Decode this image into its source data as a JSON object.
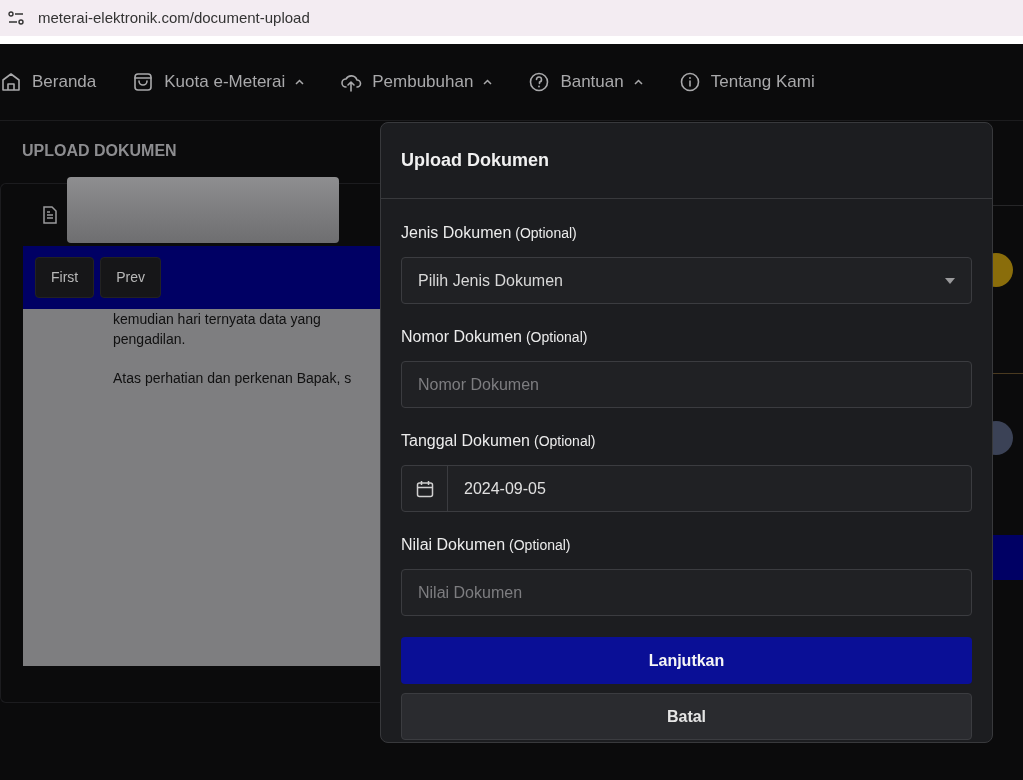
{
  "browser": {
    "url": "meterai-elektronik.com/document-upload"
  },
  "nav": [
    {
      "label": "Beranda",
      "dropdown": false
    },
    {
      "label": "Kuota e-Meterai",
      "dropdown": true
    },
    {
      "label": "Pembubuhan",
      "dropdown": true
    },
    {
      "label": "Bantuan",
      "dropdown": true
    },
    {
      "label": "Tentang Kami",
      "dropdown": false
    }
  ],
  "page": {
    "title": "UPLOAD DOKUMEN",
    "viewer": {
      "buttons": [
        "First",
        "Prev"
      ],
      "lines": [
        "kemudian hari ternyata data yang",
        "pengadilan.",
        "Atas perhatian dan perkenan Bapak, s"
      ]
    },
    "steps": [
      {
        "color": "#8a6d0b"
      },
      {
        "color": "#3b4256"
      }
    ]
  },
  "modal": {
    "title": "Upload Dokumen",
    "fields": [
      {
        "kind": "select",
        "label": "Jenis Dokumen",
        "note": "(Optional)",
        "value": "Pilih Jenis Dokumen"
      },
      {
        "kind": "text",
        "label": "Nomor Dokumen",
        "note": "(Optional)",
        "placeholder": "Nomor Dokumen"
      },
      {
        "kind": "date",
        "label": "Tanggal Dokumen",
        "note": "(Optional)",
        "value": "2024-09-05"
      },
      {
        "kind": "text",
        "label": "Nilai Dokumen",
        "note": "(Optional)",
        "placeholder": "Nilai Dokumen"
      }
    ],
    "buttons": [
      {
        "label": "Lanjutkan",
        "kind": "primary"
      },
      {
        "label": "Batal",
        "kind": "secondary"
      }
    ]
  }
}
